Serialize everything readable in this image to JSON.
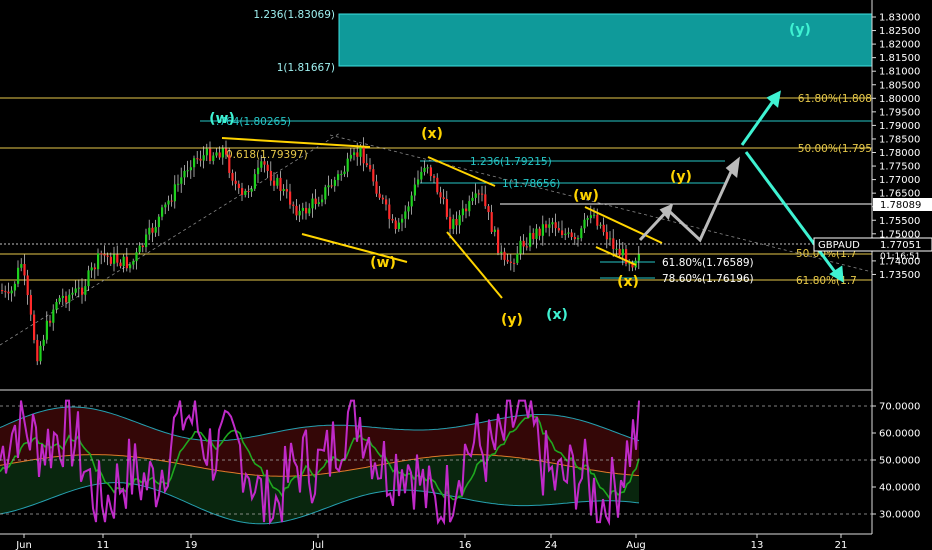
{
  "chart_data": [
    {
      "type": "candlestick",
      "symbol": "GBPAUD",
      "last_price": "1.77051",
      "countdown": "01:16:51",
      "marked_price": "1.78089",
      "y_ticks": [
        "1.83000",
        "1.82500",
        "1.82000",
        "1.81500",
        "1.81000",
        "1.80500",
        "1.80000",
        "1.79500",
        "1.79000",
        "1.78500",
        "1.78000",
        "1.77500",
        "1.77000",
        "1.76500",
        "1.76000",
        "1.75500",
        "1.75000",
        "1.74500",
        "1.74000",
        "1.73500"
      ],
      "x_ticks": [
        "Jun",
        "11",
        "19",
        "Jul",
        "16",
        "24",
        "Aug",
        "13",
        "21"
      ],
      "target_zone": {
        "top": 1.83069,
        "bottom": 1.81667,
        "top_label": "1.236(1.83069)",
        "bottom_label": "1(1.81667)",
        "wave_label": "(y)"
      },
      "fib_levels": [
        {
          "label": "61.80%(1.808",
          "price": 1.80875,
          "color": "#e6c84a"
        },
        {
          "label": ".764(1.80265)",
          "price": 1.80265,
          "color": "#26c6c6"
        },
        {
          "label": "0.618(1.79397)",
          "price": 1.79397,
          "color": "#e6c84a"
        },
        {
          "label": "50.00%(1.795",
          "price": 1.7955,
          "color": "#e6c84a"
        },
        {
          "label": "1.236(1.79215)",
          "price": 1.79215,
          "color": "#26c6c6"
        },
        {
          "label": "1(1.78656)",
          "price": 1.78656,
          "color": "#26c6c6"
        },
        {
          "label": "50.00%(1.7",
          "price": 1.7678,
          "color": "#e6c84a"
        },
        {
          "label": "61.80%(1.76589)",
          "price": 1.76589,
          "color": "#26c6c6"
        },
        {
          "label": "78.60%(1.76196)",
          "price": 1.76196,
          "color": "#26c6c6"
        },
        {
          "label": "61.80%(1.7",
          "price": 1.7618,
          "color": "#e6c84a"
        }
      ],
      "wave_labels": [
        "(w)",
        "(x)",
        "(w)",
        "(y)",
        "(x)",
        "(w)",
        "(x)",
        "(y)",
        "(y)"
      ],
      "colors": {
        "up": "#1fd11f",
        "down": "#ff2a2a",
        "fib_gold": "#e6c84a",
        "fib_cyan": "#26c6c6",
        "zone": "#0f9a9a",
        "wave_yellow": "#ffd400",
        "wave_cyan": "#3ff2d2"
      }
    },
    {
      "type": "line",
      "y_ticks": [
        "70.0000",
        "60.0000",
        "50.0000",
        "40.0000",
        "30.0000"
      ],
      "ylim": [
        25,
        73
      ],
      "reference_lines": [
        70,
        50,
        30
      ],
      "series": [],
      "colors": {
        "rsi": "#c02ac8",
        "signal": "#1fa81f",
        "mid": "#e07a2a",
        "band": "#26a0b0"
      }
    }
  ]
}
